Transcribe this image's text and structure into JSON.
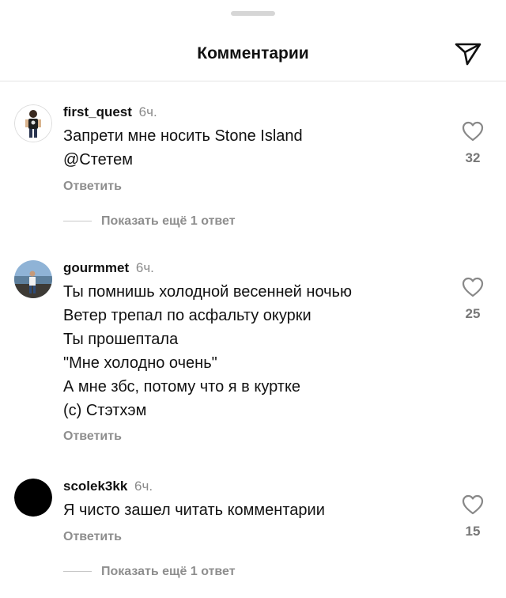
{
  "header": {
    "title": "Комментарии",
    "share_icon": "send-icon"
  },
  "reply_label": "Ответить",
  "comments": [
    {
      "username": "first_quest",
      "time": "6ч.",
      "lines": [
        "Запрети мне носить Stone Island",
        "@Стетем"
      ],
      "likes": "32",
      "more_replies": "Показать ещё 1 ответ"
    },
    {
      "username": "gourmmet",
      "time": "6ч.",
      "lines": [
        "Ты помнишь холодной весенней ночью",
        "Ветер трепал по асфальту окурки",
        "Ты прошептала",
        "\"Мне холодно очень\"",
        "А мне збс, потому что я в куртке",
        "(с) Стэтхэм"
      ],
      "likes": "25"
    },
    {
      "username": "scolek3kk",
      "time": "6ч.",
      "lines": [
        "Я чисто зашел читать комментарии"
      ],
      "likes": "15",
      "more_replies": "Показать ещё 1 ответ"
    }
  ],
  "colors": {
    "secondary_text": "#8e8e8e",
    "divider": "#e4e4e4"
  }
}
